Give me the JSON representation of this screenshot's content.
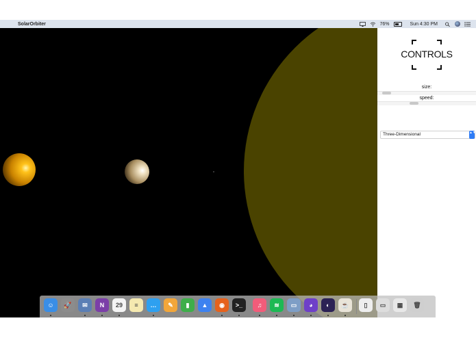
{
  "menubar": {
    "apple_glyph": "",
    "app_name": "SolarOrbiter",
    "battery_percent": "76%",
    "clock": "Sun 4:30 PM",
    "icons": [
      "airplay-icon",
      "wifi-icon",
      "battery-icon",
      "spotlight-search-icon",
      "siri-icon",
      "notification-center-icon"
    ]
  },
  "controls": {
    "logo": "CONTROLS",
    "size_label": "size:",
    "size_value": 0.05,
    "speed_label": "speed:",
    "speed_value": 0.36,
    "view_mode": "Three-Dimensional",
    "select_arrow": "▲▼"
  },
  "scene": {
    "background": "#000000",
    "sun_color": "#4a4300",
    "planet_colors": [
      "#e8a000",
      "#e3d2b0"
    ]
  },
  "dock": {
    "apps": [
      {
        "name": "finder-icon",
        "glyph": "☺",
        "color": "#3a8ee6",
        "running": true
      },
      {
        "name": "launchpad-icon",
        "glyph": "🚀",
        "color": "#8c8c8c",
        "running": false
      },
      {
        "name": "mail-stamp-icon",
        "glyph": "✉",
        "color": "#5b7fb5",
        "running": true
      },
      {
        "name": "onenote-icon",
        "glyph": "N",
        "color": "#7b3fa8",
        "running": true
      },
      {
        "name": "calendar-icon",
        "glyph": "29",
        "color": "#f4f4f4",
        "running": true
      },
      {
        "name": "notes-icon",
        "glyph": "≡",
        "color": "#f5e9b0",
        "running": false
      },
      {
        "name": "messages-icon",
        "glyph": "…",
        "color": "#2ea0f0",
        "running": true
      },
      {
        "name": "pages-icon",
        "glyph": "✎",
        "color": "#f2a63a",
        "running": false
      },
      {
        "name": "numbers-icon",
        "glyph": "▮",
        "color": "#3fae4a",
        "running": false
      },
      {
        "name": "keynote-icon",
        "glyph": "▲",
        "color": "#3e82f0",
        "running": false
      },
      {
        "name": "firefox-icon",
        "glyph": "◉",
        "color": "#e6621d",
        "running": true
      },
      {
        "name": "terminal-icon",
        "glyph": ">_",
        "color": "#222222",
        "running": true
      },
      {
        "name": "itunes-icon",
        "glyph": "♫",
        "color": "#f25c7a",
        "running": true
      },
      {
        "name": "spotify-icon",
        "glyph": "≋",
        "color": "#1db954",
        "running": true
      },
      {
        "name": "preview-icon",
        "glyph": "▭",
        "color": "#7e9ec6",
        "running": true
      },
      {
        "name": "github-icon",
        "glyph": "◕",
        "color": "#6e40c9",
        "running": true
      },
      {
        "name": "eclipse-icon",
        "glyph": "◐",
        "color": "#2c2255",
        "running": true
      },
      {
        "name": "java-icon",
        "glyph": "☕",
        "color": "#e9e4d8",
        "running": true
      },
      {
        "name": "document-icon",
        "glyph": "▯",
        "color": "#eeeeee",
        "running": false
      },
      {
        "name": "window-thumbnail-icon",
        "glyph": "▭",
        "color": "#dddddd",
        "running": false
      },
      {
        "name": "screenshot-file-icon",
        "glyph": "▦",
        "color": "#e8e8e8",
        "running": false
      },
      {
        "name": "trash-icon",
        "glyph": "🗑",
        "color": "#cfcfcf",
        "running": false
      }
    ]
  }
}
